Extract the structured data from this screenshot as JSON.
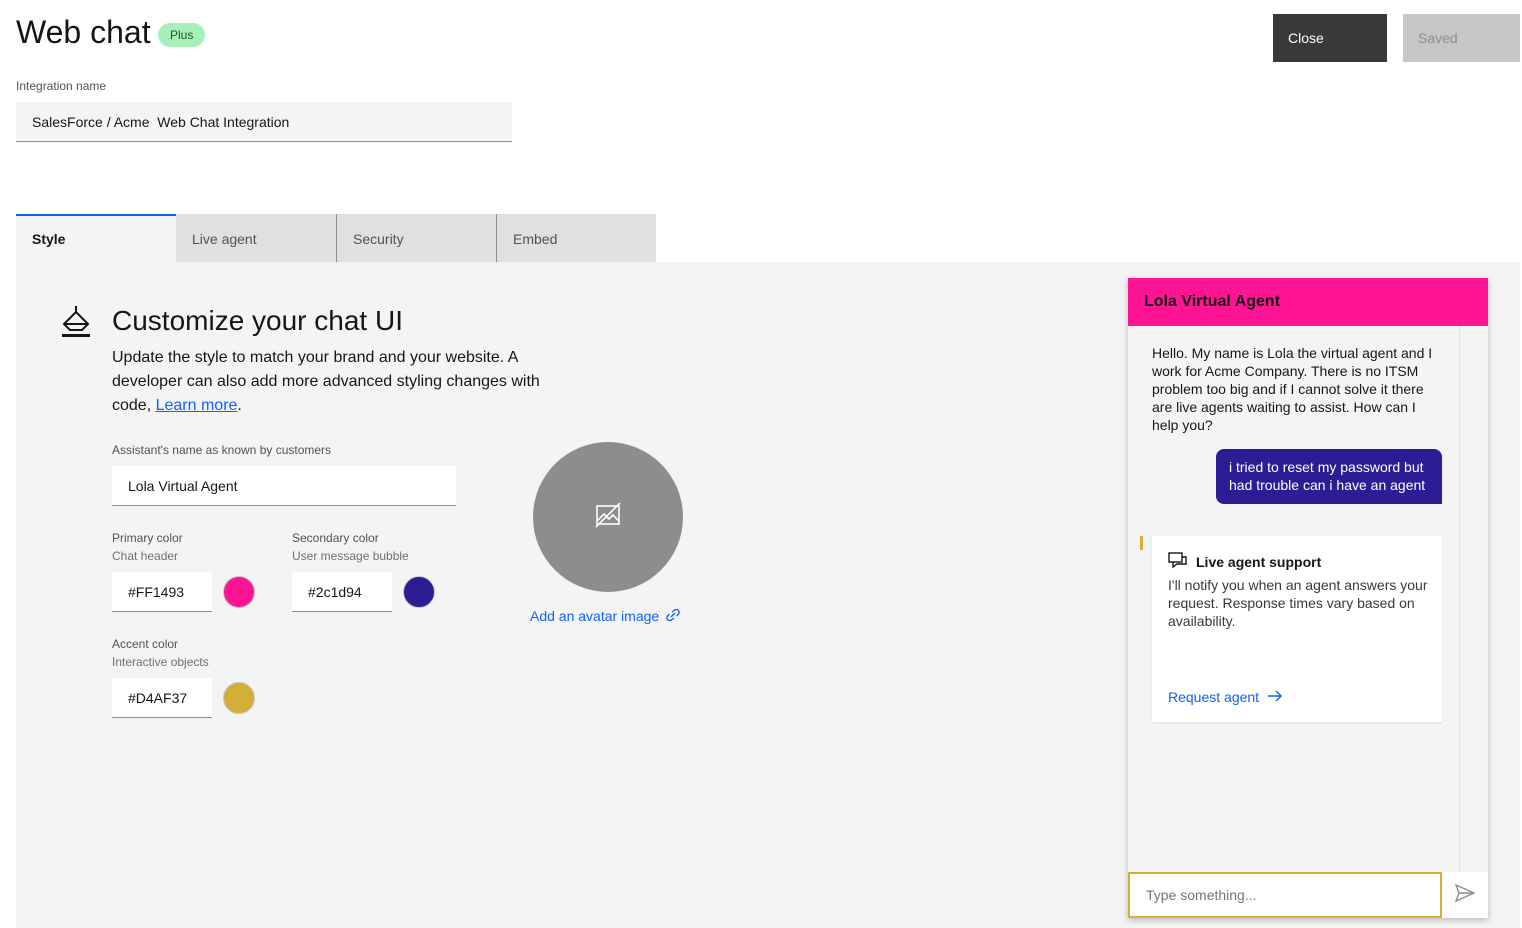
{
  "page": {
    "title": "Web chat",
    "plan_tag": "Plus",
    "close_label": "Close",
    "saved_label": "Saved"
  },
  "integration": {
    "label": "Integration name",
    "value": "SalesForce / Acme  Web Chat Integration"
  },
  "tabs": [
    {
      "label": "Style",
      "active": true
    },
    {
      "label": "Live agent",
      "active": false
    },
    {
      "label": "Security",
      "active": false
    },
    {
      "label": "Embed",
      "active": false
    }
  ],
  "style_section": {
    "icon": "paint-brush-icon",
    "title": "Customize your chat UI",
    "description": "Update the style to match your brand and your website. A developer can also add more advanced styling changes with code, ",
    "learn_more": "Learn more",
    "description_end": ".",
    "assistant_name_label": "Assistant's name as known by customers",
    "assistant_name_value": "Lola Virtual Agent",
    "primary_color": {
      "label": "Primary color",
      "helper": "Chat header",
      "value": "#FF1493",
      "swatch": "#ff1493"
    },
    "secondary_color": {
      "label": "Secondary color",
      "helper": "User message bubble",
      "value": "#2c1d94",
      "swatch": "#2c1d94"
    },
    "accent_color": {
      "label": "Accent color",
      "helper": "Interactive objects",
      "value": "#D4AF37",
      "swatch": "#d4af37"
    },
    "avatar_link": "Add an avatar image"
  },
  "chat_preview": {
    "header": "Lola Virtual Agent",
    "bot_message": "Hello. My name is Lola the virtual agent and I work for Acme Company. There is no ITSM problem too big and if I cannot solve it there are live agents waiting to assist. How can I help you?",
    "user_message": "i tried to reset my password but had trouble can i have an agent",
    "card_title": "Live agent support",
    "card_body": "I'll notify you when an agent answers your request. Response times vary based on availability.",
    "card_link": "Request agent",
    "input_placeholder": "Type something..."
  }
}
